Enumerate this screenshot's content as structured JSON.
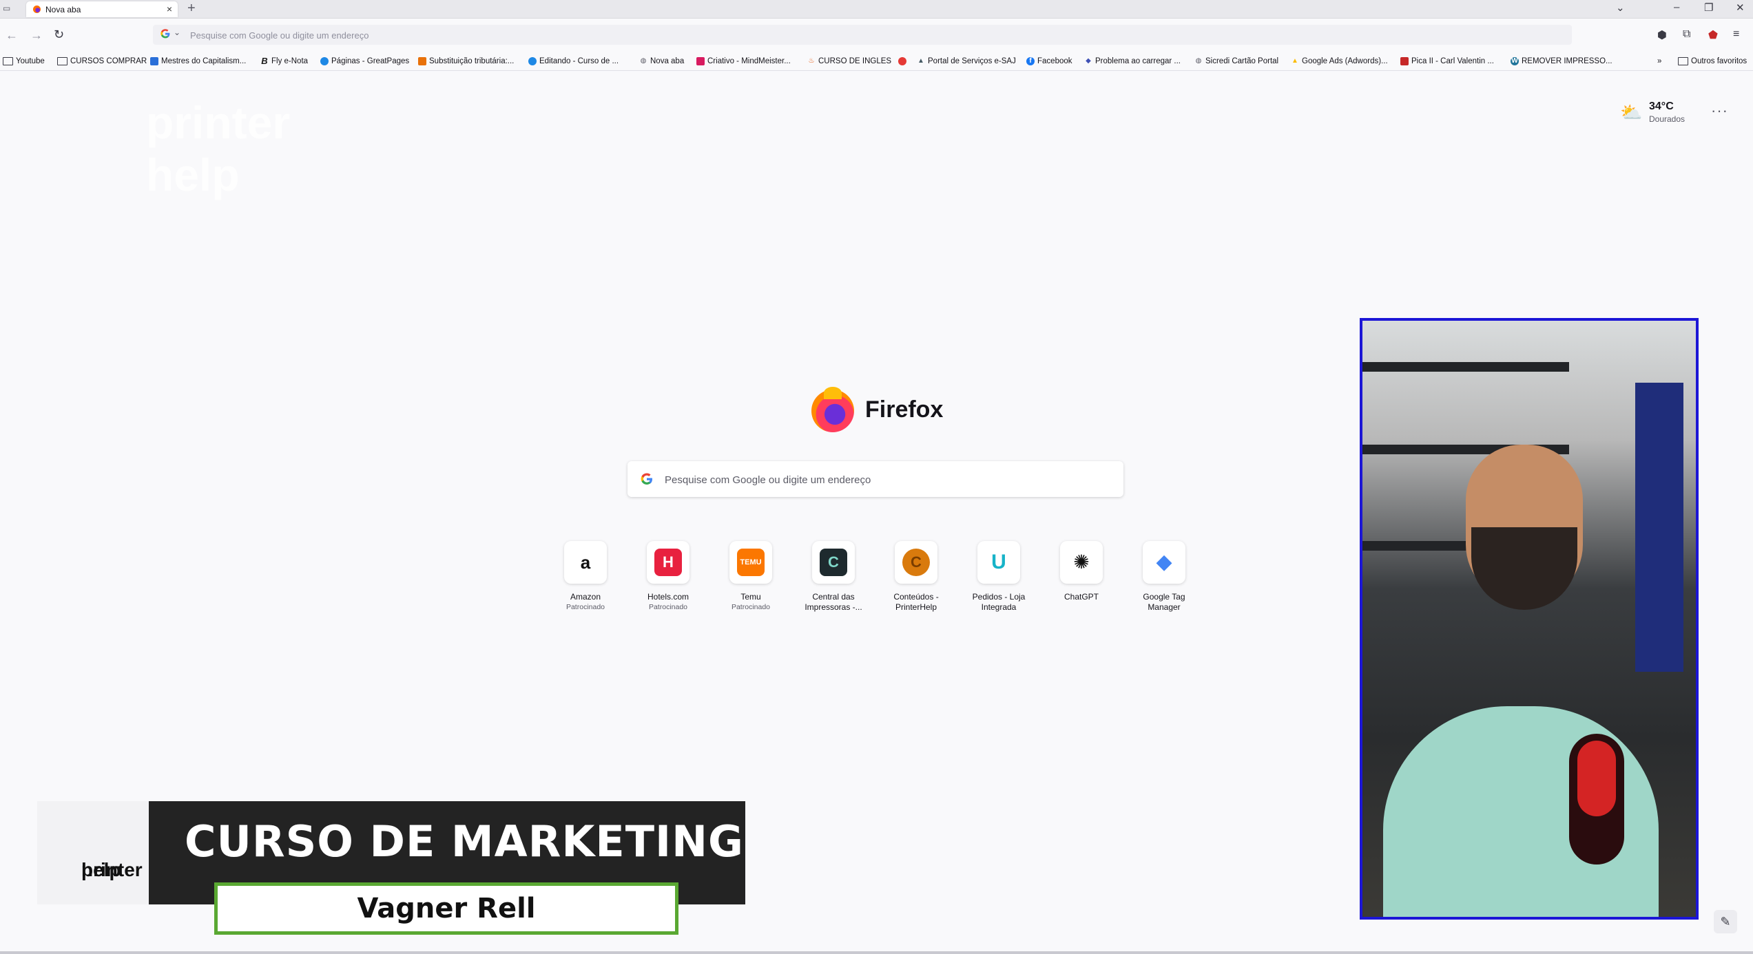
{
  "tab": {
    "title": "Nova aba"
  },
  "urlbar": {
    "placeholder": "Pesquise com Google ou digite um endereço"
  },
  "bookmarks": [
    {
      "label": "Youtube",
      "icon": "folder-icon",
      "color": "#3a3a44"
    },
    {
      "label": "CURSOS COMPRAR",
      "icon": "folder-icon",
      "color": "#3a3a44"
    },
    {
      "label": "Mestres do Capitalism...",
      "icon": "site-icon",
      "color": "#2a6fd8"
    },
    {
      "label": "Fly e-Nota",
      "icon": "b-logo-icon",
      "color": "#1a1a1a"
    },
    {
      "label": "Páginas - GreatPages",
      "icon": "site-icon",
      "color": "#1e88e5"
    },
    {
      "label": "Substituição tributária:...",
      "icon": "site-icon",
      "color": "#e8710a"
    },
    {
      "label": "Editando - Curso de ...",
      "icon": "site-icon",
      "color": "#1e88e5"
    },
    {
      "label": "Nova aba",
      "icon": "globe-icon",
      "color": "#5b5b66"
    },
    {
      "label": "Criativo - MindMeister...",
      "icon": "site-icon",
      "color": "#d81b60"
    },
    {
      "label": "CURSO DE INGLES",
      "icon": "fire-icon",
      "color": "#e65100"
    },
    {
      "label": "",
      "icon": "hotmart-icon",
      "color": "#e53935"
    },
    {
      "label": "Portal de Serviços e-SAJ",
      "icon": "site-icon",
      "color": "#455a64"
    },
    {
      "label": "Facebook",
      "icon": "facebook-icon",
      "color": "#1877f2"
    },
    {
      "label": "Problema ao carregar ...",
      "icon": "site-icon",
      "color": "#3f51b5"
    },
    {
      "label": "Sicredi Cartão Portal",
      "icon": "globe-icon",
      "color": "#5b5b66"
    },
    {
      "label": "Google Ads (Adwords)...",
      "icon": "ads-icon",
      "color": "#fbbc04"
    },
    {
      "label": "Pica II - Carl Valentin ...",
      "icon": "site-icon",
      "color": "#c62828"
    },
    {
      "label": "REMOVER IMPRESSO...",
      "icon": "wordpress-icon",
      "color": "#21759b"
    }
  ],
  "bookmarks_overflow": "»",
  "other_bookmarks": "Outros favoritos",
  "ghost_logo": {
    "line1": "printer",
    "line2": "help"
  },
  "weather": {
    "temp": "34°C",
    "city": "Dourados"
  },
  "brand": {
    "name": "Firefox"
  },
  "search": {
    "placeholder": "Pesquise com Google ou digite um endereço"
  },
  "shortcuts": [
    {
      "label": "Amazon",
      "sub": "Patrocinado",
      "glyph": "a",
      "bg": "#ffffff",
      "fg": "#111111"
    },
    {
      "label": "Hotels.com",
      "sub": "Patrocinado",
      "glyph": "H",
      "bg": "#e8213f",
      "fg": "#ffffff"
    },
    {
      "label": "Temu",
      "sub": "Patrocinado",
      "glyph": "TEMU",
      "bg": "#fb7701",
      "fg": "#ffffff"
    },
    {
      "label": "Central das Impressoras -...",
      "sub": "",
      "glyph": "C",
      "bg": "#1e2a2e",
      "fg": "#7fd6c8"
    },
    {
      "label": "Conteúdos - PrinterHelp",
      "sub": "",
      "glyph": "C",
      "bg": "#d97a0d",
      "fg": "#7a3d00"
    },
    {
      "label": "Pedidos - Loja Integrada",
      "sub": "",
      "glyph": "U",
      "bg": "#ffffff",
      "fg": "#17b3c8"
    },
    {
      "label": "ChatGPT",
      "sub": "",
      "glyph": "✺",
      "bg": "#ffffff",
      "fg": "#111111"
    },
    {
      "label": "Google Tag Manager",
      "sub": "",
      "glyph": "◆",
      "bg": "#ffffff",
      "fg": "#4285f4"
    }
  ],
  "lower_third": {
    "logo_line1": "printer",
    "logo_line2": "help",
    "title": "CURSO DE MARKETING",
    "name": "Vagner Rell",
    "accent": "#5aa832"
  },
  "webcam": {
    "border_color": "#1c16d6"
  }
}
